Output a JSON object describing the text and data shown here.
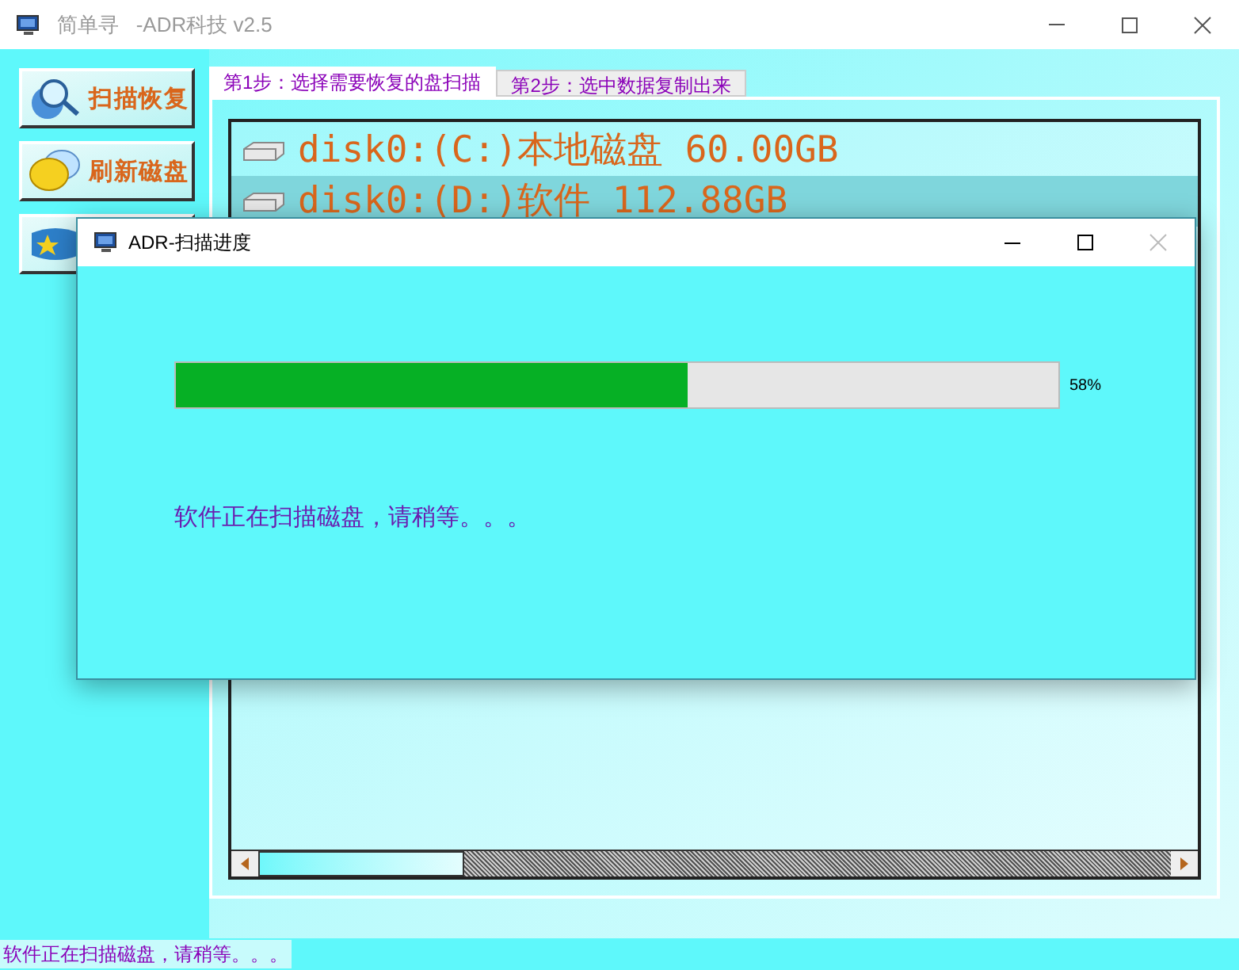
{
  "window": {
    "title": "简单寻   -ADR科技 v2.5"
  },
  "side_buttons": [
    {
      "label": "扫描恢复",
      "kind": "scan"
    },
    {
      "label": "刷新磁盘",
      "kind": "refresh"
    },
    {
      "kind": "tools"
    }
  ],
  "tabs": [
    {
      "label": "第1步：选择需要恢复的盘扫描",
      "selected": true
    },
    {
      "label": "第2步：选中数据复制出来",
      "selected": false
    }
  ],
  "disks": [
    {
      "label": "disk0:(C:)本地磁盘 60.00GB",
      "selected": false
    },
    {
      "label": "disk0:(D:)软件 112.88GB",
      "selected": true
    }
  ],
  "dialog": {
    "title": "ADR-扫描进度",
    "level": 0.58,
    "percent": "58%",
    "message": "软件正在扫描磁盘，请稍等。。。"
  },
  "status_bar": "软件正在扫描磁盘，请稍等。。。"
}
